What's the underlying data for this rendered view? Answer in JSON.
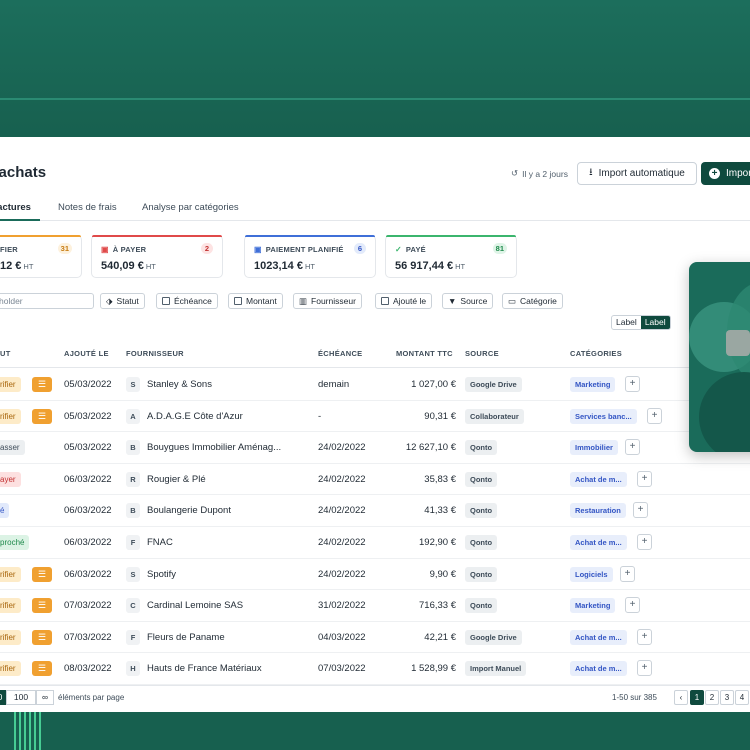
{
  "page": {
    "title": "s achats",
    "sync_text": "Il y a 2 jours",
    "import_auto_label": "Import automatique",
    "import_label": "Impor"
  },
  "tabs": [
    "factures",
    "Notes de frais",
    "Analyse par catégories"
  ],
  "summary_cards": [
    {
      "label": "FIER",
      "count": "31",
      "amount": "12 €",
      "unit": "HT",
      "color": "#f0a030",
      "count_bg": "#fdf1dd",
      "count_color": "#c77b10"
    },
    {
      "label": "À PAYER",
      "count": "2",
      "amount": "540,09 €",
      "unit": "HT",
      "color": "#e04a4a",
      "count_bg": "#fde3e3",
      "count_color": "#c23030"
    },
    {
      "label": "PAIEMENT PLANIFIÉ",
      "count": "6",
      "amount": "1023,14 €",
      "unit": "HT",
      "color": "#3f6fd8",
      "count_bg": "#e3ebfb",
      "count_color": "#3355c4"
    },
    {
      "label": "PAYÉ",
      "count": "81",
      "amount": "56 917,44 €",
      "unit": "HT",
      "color": "#3bb56d",
      "count_bg": "#dff4e7",
      "count_color": "#1f8a4c"
    }
  ],
  "filters": {
    "search_placeholder": "holder",
    "buttons": [
      "Statut",
      "Échéance",
      "Montant",
      "Fournisseur",
      "Ajouté le",
      "Source",
      "Catégorie"
    ]
  },
  "label_toggle": [
    "Label",
    "Label"
  ],
  "table": {
    "headers": [
      "UT",
      "AJOUTÉ LE",
      "FOURNISSEUR",
      "ÉCHÉANCE",
      "MONTANT TTC",
      "SOURCE",
      "CATÉGORIES"
    ],
    "rows": [
      {
        "status": "rifier",
        "status_type": "verify",
        "alert": true,
        "added": "05/03/2022",
        "initial": "S",
        "supplier": "Stanley & Sons",
        "due": "demain",
        "amount": "1 027,00 €",
        "source": "Google Drive",
        "category": "Marketing"
      },
      {
        "status": "rifier",
        "status_type": "verify",
        "alert": true,
        "added": "05/03/2022",
        "initial": "A",
        "supplier": "A.D.A.G.E Côte d'Azur",
        "due": "-",
        "amount": "90,31 €",
        "source": "Collaborateur",
        "category": "Services banc..."
      },
      {
        "status": "asser",
        "status_type": "neutral",
        "alert": false,
        "added": "05/03/2022",
        "initial": "B",
        "supplier": "Bouygues Immobilier Aménag...",
        "due": "24/02/2022",
        "amount": "12 627,10 €",
        "source": "Qonto",
        "category": "Immobilier"
      },
      {
        "status": "ayer",
        "status_type": "pay",
        "alert": false,
        "added": "06/03/2022",
        "initial": "R",
        "supplier": "Rougier & Plé",
        "due": "24/02/2022",
        "amount": "35,83 €",
        "source": "Qonto",
        "category": "Achat de m..."
      },
      {
        "status": "é",
        "status_type": "planned",
        "alert": false,
        "added": "06/03/2022",
        "initial": "B",
        "supplier": "Boulangerie Dupont",
        "due": "24/02/2022",
        "amount": "41,33 €",
        "source": "Qonto",
        "category": "Restauration"
      },
      {
        "status": "proché",
        "status_type": "matched",
        "alert": false,
        "added": "06/03/2022",
        "initial": "F",
        "supplier": "FNAC",
        "due": "24/02/2022",
        "amount": "192,90 €",
        "source": "Qonto",
        "category": "Achat de m..."
      },
      {
        "status": "rifier",
        "status_type": "verify",
        "alert": true,
        "added": "06/03/2022",
        "initial": "S",
        "supplier": "Spotify",
        "due": "24/02/2022",
        "amount": "9,90 €",
        "source": "Qonto",
        "category": "Logiciels"
      },
      {
        "status": "rifier",
        "status_type": "verify",
        "alert": true,
        "added": "07/03/2022",
        "initial": "C",
        "supplier": "Cardinal Lemoine SAS",
        "due": "31/02/2022",
        "amount": "716,33 €",
        "source": "Qonto",
        "category": "Marketing"
      },
      {
        "status": "rifier",
        "status_type": "verify",
        "alert": true,
        "added": "07/03/2022",
        "initial": "F",
        "supplier": "Fleurs de Paname",
        "due": "04/03/2022",
        "amount": "42,21 €",
        "source": "Google Drive",
        "category": "Achat de m..."
      },
      {
        "status": "rifier",
        "status_type": "verify",
        "alert": true,
        "added": "08/03/2022",
        "initial": "H",
        "supplier": "Hauts de France Matériaux",
        "due": "07/03/2022",
        "amount": "1 528,99 €",
        "source": "Import Manuel",
        "category": "Achat de m..."
      }
    ]
  },
  "footer": {
    "per_page": [
      "0",
      "100",
      "∞"
    ],
    "per_page_label": "éléments par page",
    "range_text": "1-50 sur 385",
    "prev": "‹",
    "pages": [
      "1",
      "2",
      "3",
      "4"
    ]
  },
  "status_colors": {
    "verify": {
      "bg": "#fdebc8",
      "fg": "#a8650c"
    },
    "neutral": {
      "bg": "#eceff1",
      "fg": "#3e4c59"
    },
    "pay": {
      "bg": "#fde0e0",
      "fg": "#c23030"
    },
    "planned": {
      "bg": "#e1e9fb",
      "fg": "#3355c4"
    },
    "matched": {
      "bg": "#dcf3e5",
      "fg": "#1f8a4c"
    }
  }
}
